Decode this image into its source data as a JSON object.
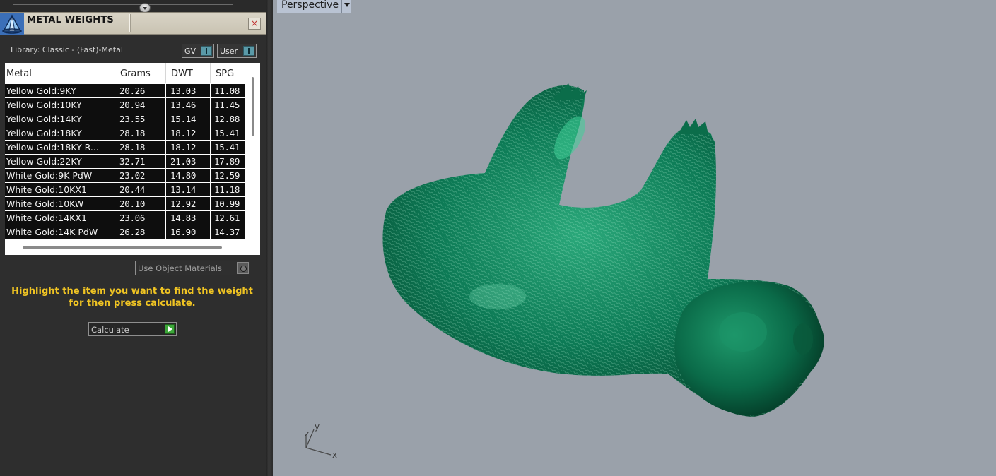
{
  "panel": {
    "title": "METAL WEIGHTS",
    "close_label": "×",
    "library_label": "Library: Classic - (Fast)-Metal",
    "toggles": {
      "gv": "GV",
      "user": "User"
    },
    "table": {
      "headers": {
        "metal": "Metal",
        "grams": "Grams",
        "dwt": "DWT",
        "spg": "SPG"
      },
      "rows": [
        {
          "metal": "Yellow Gold:9KY",
          "grams": "20.26",
          "dwt": "13.03",
          "spg": "11.08"
        },
        {
          "metal": "Yellow Gold:10KY",
          "grams": "20.94",
          "dwt": "13.46",
          "spg": "11.45"
        },
        {
          "metal": "Yellow Gold:14KY",
          "grams": "23.55",
          "dwt": "15.14",
          "spg": "12.88"
        },
        {
          "metal": "Yellow Gold:18KY",
          "grams": "28.18",
          "dwt": "18.12",
          "spg": "15.41"
        },
        {
          "metal": "Yellow Gold:18KY R...",
          "grams": "28.18",
          "dwt": "18.12",
          "spg": "15.41"
        },
        {
          "metal": "Yellow Gold:22KY",
          "grams": "32.71",
          "dwt": "21.03",
          "spg": "17.89"
        },
        {
          "metal": "White Gold:9K PdW",
          "grams": "23.02",
          "dwt": "14.80",
          "spg": "12.59"
        },
        {
          "metal": "White Gold:10KX1",
          "grams": "20.44",
          "dwt": "13.14",
          "spg": "11.18"
        },
        {
          "metal": "White Gold:10KW",
          "grams": "20.10",
          "dwt": "12.92",
          "spg": "10.99"
        },
        {
          "metal": "White Gold:14KX1",
          "grams": "23.06",
          "dwt": "14.83",
          "spg": "12.61"
        },
        {
          "metal": "White Gold:14K PdW",
          "grams": "26.28",
          "dwt": "16.90",
          "spg": "14.37"
        }
      ]
    },
    "use_object_materials": "Use Object Materials",
    "instructions": "Highlight the item you want to find the weight for then press calculate.",
    "calculate_label": "Calculate"
  },
  "viewport": {
    "name": "Perspective",
    "model_color": "#0c7a55",
    "background_color": "#9aa1aa",
    "axis_labels": {
      "x": "x",
      "y": "y",
      "z": "z"
    }
  },
  "icons": {
    "app_logo": "metal-weights-logo-icon",
    "close": "close-icon",
    "slider": "slider-knob-icon",
    "viewport_menu": "chevron-down-icon",
    "calculate": "play-arrow-icon"
  }
}
